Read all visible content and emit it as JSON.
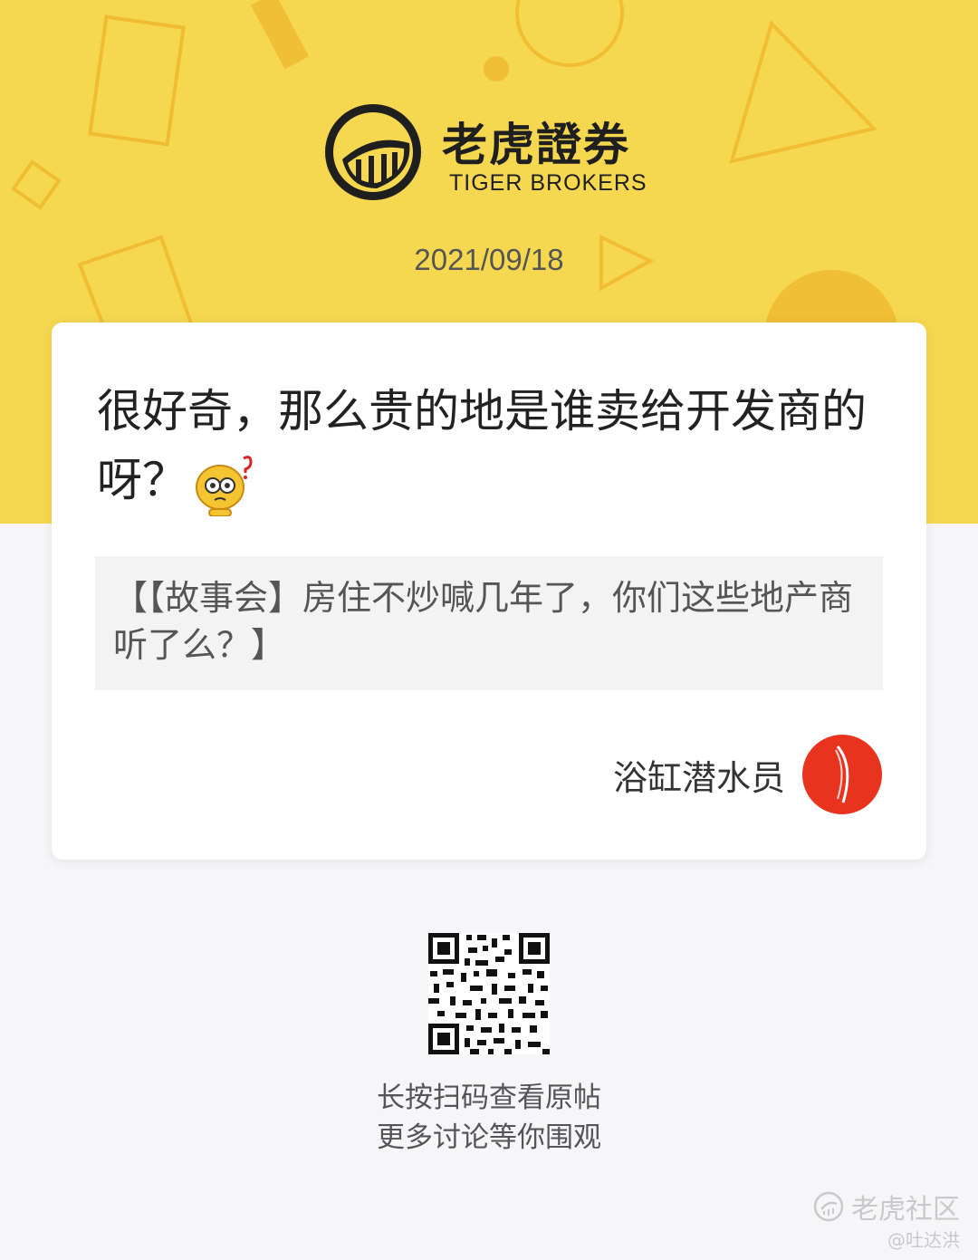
{
  "brand": {
    "name_cn": "老虎證券",
    "name_en": "TIGER BROKERS"
  },
  "post": {
    "date": "2021/09/18",
    "title": "很好奇，那么贵的地是谁卖给开发商的呀？",
    "sticker_icon": "confused-tiger-sticker",
    "quote": "【【故事会】房住不炒喊几年了，你们这些地产商听了么？】",
    "author_name": "浴缸潜水员"
  },
  "qr": {
    "caption_line1": "长按扫码查看原帖",
    "caption_line2": "更多讨论等你围观"
  },
  "watermark": {
    "label": "老虎社区",
    "handle": "@吐达洪"
  },
  "colors": {
    "brand_yellow": "#f5d84f",
    "card_bg": "#ffffff",
    "page_bg": "#f6f6f8",
    "avatar_red": "#e8341f"
  }
}
